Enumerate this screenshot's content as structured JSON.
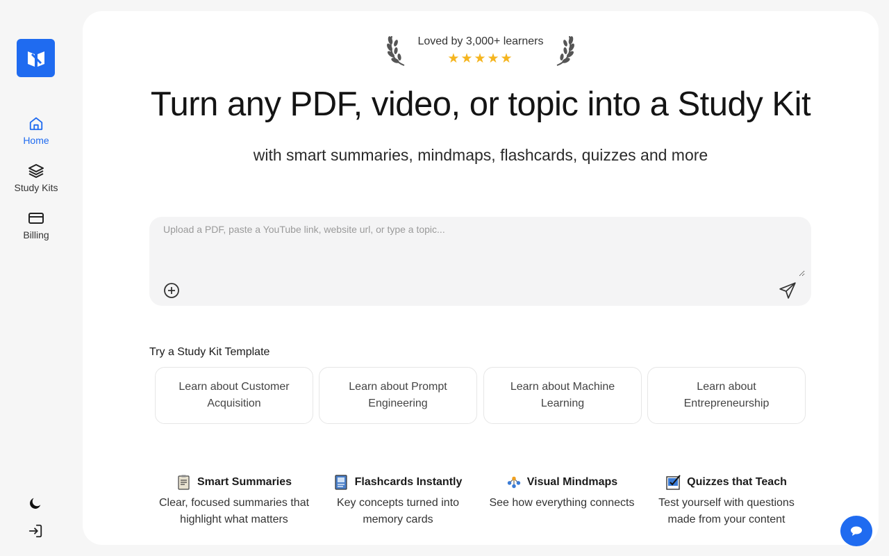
{
  "sidebar": {
    "logo": "app-logo",
    "items": [
      {
        "label": "Home",
        "icon": "home-icon",
        "active": true
      },
      {
        "label": "Study Kits",
        "icon": "layers-icon",
        "active": false
      },
      {
        "label": "Billing",
        "icon": "credit-card-icon",
        "active": false
      }
    ],
    "bottom_icons": [
      "moon-icon",
      "login-icon"
    ]
  },
  "hero": {
    "badge_text": "Loved by 3,000+ learners",
    "stars": "★★★★★",
    "title": "Turn any PDF, video, or topic into a Study Kit",
    "subtitle": "with smart summaries, mindmaps, flashcards, quizzes and more"
  },
  "input": {
    "placeholder": "Upload a PDF, paste a YouTube link, website url, or type a topic...",
    "value": ""
  },
  "templates": {
    "heading": "Try a Study Kit Template",
    "items": [
      {
        "label": "Learn about Customer Acquisition"
      },
      {
        "label": "Learn about Prompt Engineering"
      },
      {
        "label": "Learn about Machine Learning"
      },
      {
        "label": "Learn about Entrepreneurship"
      }
    ]
  },
  "features": [
    {
      "title": "Smart Summaries",
      "desc": "Clear, focused summaries that highlight what matters",
      "icon": "summary-icon"
    },
    {
      "title": "Flashcards Instantly",
      "desc": "Key concepts turned into memory cards",
      "icon": "flashcard-icon"
    },
    {
      "title": "Visual Mindmaps",
      "desc": "See how everything connects",
      "icon": "mindmap-icon"
    },
    {
      "title": "Quizzes that Teach",
      "desc": "Test yourself with questions made from your content",
      "icon": "quiz-icon"
    }
  ],
  "colors": {
    "accent": "#1f6bf0",
    "star": "#f5b51f",
    "background": "#f6f6f6",
    "panel": "#ffffff"
  }
}
